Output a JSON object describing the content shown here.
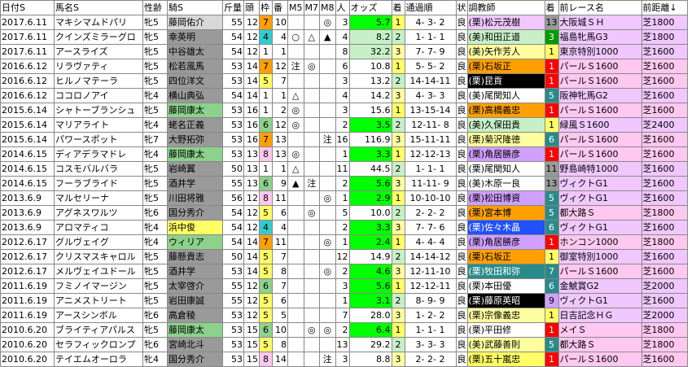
{
  "headers": [
    "日付S",
    "馬名S",
    "性齢",
    "騎S",
    "斤量",
    "頭",
    "枠",
    "番",
    "M5",
    "M7",
    "M8",
    "人",
    "オッズ",
    "着",
    "通過順",
    "状",
    "調教師",
    "着",
    "前レース名",
    "前距離↓"
  ],
  "rows": [
    {
      "date": "2017.6.11",
      "horse": "マキシマムドパリ",
      "sexage": "牝5",
      "jockey": "藤岡佑介",
      "kinryo": "55",
      "heads": "12",
      "waku": "7",
      "ban": "10",
      "m5": "",
      "m7": "",
      "m8": "◎",
      "ninki": "3",
      "odds": "5.7",
      "chaku": "1",
      "tsuka": "4- 3- 2",
      "jo": "良",
      "trainer": "(栗)松元茂樹",
      "prev_chaku": "13",
      "prev_race": "大阪城ＳＨ",
      "prev_dist": "芝1800",
      "jrow": "bg-wgray",
      "wakuc": "bg-orange",
      "oddsc": "bg-zgreen",
      "chakuc": "bg-yellow",
      "trc": "bg-lavender",
      "pcc": "bg-mgray",
      "prc": "bg-lavender",
      "pdc": "bg-lavender"
    },
    {
      "date": "2017.6.11",
      "horse": "クインズミラーグロ",
      "sexage": "牝5",
      "jockey": "幸英明",
      "kinryo": "54",
      "heads": "12",
      "waku": "4",
      "ban": "4",
      "m5": "○",
      "m7": "△",
      "m8": "▲",
      "ninki": "4",
      "odds": "8.2",
      "chaku": "2",
      "tsuka": "1- 1- 1",
      "jo": "良",
      "trainer": "(美)和田正道",
      "prev_chaku": "3",
      "prev_race": "福島牝馬G3",
      "prev_dist": "芝1800",
      "jrow": "bg-mgray",
      "wakuc": "bg-cyan",
      "oddsc": "bg-lgreen",
      "chakuc": "bg-lgreen",
      "trc": "bg-lgreen",
      "pcc": "bg-dkgreen",
      "prc": "bg-lavender",
      "pdc": "bg-lavender"
    },
    {
      "date": "2017.6.11",
      "horse": "アースライズ",
      "sexage": "牝5",
      "jockey": "中谷雄太",
      "kinryo": "54",
      "heads": "12",
      "waku": "1",
      "ban": "1",
      "m5": "",
      "m7": "",
      "m8": "",
      "ninki": "8",
      "odds": "32.2",
      "chaku": "3",
      "tsuka": "7- 7- 9",
      "jo": "良",
      "trainer": "(美)矢作芳人",
      "prev_chaku": "1",
      "prev_race": "東京特別1000",
      "prev_dist": "芝1600",
      "jrow": "bg-mgray",
      "wakuc": "",
      "oddsc": "bg-lgreen",
      "chakuc": "bg-lyellow",
      "trc": "bg-lyellow",
      "pcc": "bg-yellow",
      "prc": "bg-lavender",
      "pdc": "bg-lavender"
    },
    {
      "date": "2016.6.12",
      "horse": "リラヴァティ",
      "sexage": "牝5",
      "jockey": "松若風馬",
      "kinryo": "53",
      "heads": "14",
      "waku": "7",
      "ban": "12",
      "m5": "注",
      "m7": "◎",
      "m8": "",
      "ninki": "6",
      "odds": "10.8",
      "chaku": "1",
      "tsuka": "5- 5- 2",
      "jo": "良",
      "trainer": "(栗)石坂正",
      "prev_chaku": "1",
      "prev_race": "パールＳ1600",
      "prev_dist": "芝1600",
      "jrow": "bg-mgray",
      "wakuc": "bg-orange",
      "oddsc": "",
      "chakuc": "bg-yellow",
      "trc": "bg-orange",
      "pcc": "bg-red",
      "prc": "bg-pink",
      "pdc": "bg-pink"
    },
    {
      "date": "2016.6.12",
      "horse": "ヒルノマテーラ",
      "sexage": "牝5",
      "jockey": "四位洋文",
      "kinryo": "53",
      "heads": "14",
      "waku": "5",
      "ban": "7",
      "m5": "",
      "m7": "",
      "m8": "",
      "ninki": "3",
      "odds": "13.2",
      "chaku": "2",
      "tsuka": "14-14-11",
      "jo": "良",
      "trainer": "(栗)昆貢",
      "prev_chaku": "1",
      "prev_race": "パールＳ1600",
      "prev_dist": "芝1600",
      "jrow": "bg-mgray",
      "wakuc": "bg-yellow",
      "oddsc": "",
      "chakuc": "bg-lgreen",
      "trc": "bg-black",
      "pcc": "bg-red",
      "prc": "bg-pink",
      "pdc": "bg-pink"
    },
    {
      "date": "2016.6.12",
      "horse": "ココロノアイ",
      "sexage": "牝4",
      "jockey": "横山典弘",
      "kinryo": "54",
      "heads": "14",
      "waku": "1",
      "ban": "1",
      "m5": "△",
      "m7": "",
      "m8": "",
      "ninki": "4",
      "odds": "14.2",
      "chaku": "3",
      "tsuka": "4- 3- 3",
      "jo": "良",
      "trainer": "(美)尾関知人",
      "prev_chaku": "5",
      "prev_race": "阪神牝馬G2",
      "prev_dist": "芝1600",
      "jrow": "bg-mgray",
      "wakuc": "",
      "oddsc": "",
      "chakuc": "bg-lyellow",
      "trc": "",
      "pcc": "bg-teal",
      "prc": "bg-lavender",
      "pdc": "bg-lavender"
    },
    {
      "date": "2015.6.14",
      "horse": "シャトーブランシュ",
      "sexage": "牝5",
      "jockey": "藤岡康太",
      "kinryo": "53",
      "heads": "16",
      "waku": "1",
      "ban": "2",
      "m5": "◎",
      "m7": "",
      "m8": "",
      "ninki": "3",
      "odds": "15.6",
      "chaku": "1",
      "tsuka": "13-15-14",
      "jo": "良",
      "trainer": "(栗)高橋義忠",
      "prev_chaku": "1",
      "prev_race": "パールＳ1600",
      "prev_dist": "芝1600",
      "jrow": "bg-green",
      "wakuc": "",
      "oddsc": "",
      "chakuc": "bg-yellow",
      "trc": "bg-orange",
      "pcc": "bg-red",
      "prc": "bg-pink",
      "pdc": "bg-pink"
    },
    {
      "date": "2015.6.14",
      "horse": "マリアライト",
      "sexage": "牝4",
      "jockey": "蛯名正義",
      "kinryo": "53",
      "heads": "16",
      "waku": "6",
      "ban": "12",
      "m5": "◎",
      "m7": "",
      "m8": "",
      "ninki": "2",
      "odds": "3.5",
      "chaku": "2",
      "tsuka": "12-11- 8",
      "jo": "良",
      "trainer": "(美)久保田貴",
      "prev_chaku": "1",
      "prev_race": "緑風Ｓ1600",
      "prev_dist": "芝2400",
      "jrow": "bg-mgray",
      "wakuc": "bg-green",
      "oddsc": "bg-zgreen",
      "chakuc": "bg-lgreen",
      "trc": "bg-lgreen",
      "pcc": "bg-yellow",
      "prc": "bg-lavender",
      "pdc": "bg-lavender"
    },
    {
      "date": "2015.6.14",
      "horse": "パワースポット",
      "sexage": "牝7",
      "jockey": "大野拓弥",
      "kinryo": "53",
      "heads": "16",
      "waku": "7",
      "ban": "13",
      "m5": "",
      "m7": "",
      "m8": "注",
      "ninki": "16",
      "odds": "116.9",
      "chaku": "3",
      "tsuka": "15-11-11",
      "jo": "良",
      "trainer": "(栗)菊沢隆徳",
      "prev_chaku": "6",
      "prev_race": "パールＳ1600",
      "prev_dist": "芝1600",
      "jrow": "bg-mgray",
      "wakuc": "bg-orange",
      "oddsc": "",
      "chakuc": "bg-lyellow",
      "trc": "bg-lyellow",
      "pcc": "bg-teal",
      "prc": "bg-pink",
      "pdc": "bg-pink"
    },
    {
      "date": "2014.6.15",
      "horse": "ディアデラマドレ",
      "sexage": "牝4",
      "jockey": "藤岡康太",
      "kinryo": "53",
      "heads": "13",
      "waku": "8",
      "ban": "13",
      "m5": "◎",
      "m7": "",
      "m8": "",
      "ninki": "1",
      "odds": "3.3",
      "chaku": "1",
      "tsuka": "12-12-13",
      "jo": "良",
      "trainer": "(栗)角居勝彦",
      "prev_chaku": "1",
      "prev_race": "パールＳ1600",
      "prev_dist": "芝1600",
      "jrow": "bg-green",
      "wakuc": "bg-pink",
      "oddsc": "bg-zgreen",
      "chakuc": "bg-yellow",
      "trc": "bg-purple",
      "pcc": "bg-red",
      "prc": "bg-pink",
      "pdc": "bg-pink"
    },
    {
      "date": "2014.6.15",
      "horse": "コスモバルバラ",
      "sexage": "牝5",
      "jockey": "岩崎翼",
      "kinryo": "50",
      "heads": "13",
      "waku": "1",
      "ban": "1",
      "m5": "△",
      "m7": "",
      "m8": "",
      "ninki": "11",
      "odds": "44.5",
      "chaku": "2",
      "tsuka": "1- 1- 1",
      "jo": "良",
      "trainer": "(栗)尾関知人",
      "prev_chaku": "11",
      "prev_race": "野島崎特1000",
      "prev_dist": "芝1600",
      "jrow": "bg-mgray",
      "wakuc": "",
      "oddsc": "",
      "chakuc": "bg-lgreen",
      "trc": "",
      "pcc": "bg-mgray",
      "prc": "bg-lavender",
      "pdc": "bg-lavender"
    },
    {
      "date": "2014.6.15",
      "horse": "フーラブライド",
      "sexage": "牝5",
      "jockey": "酒井学",
      "kinryo": "55",
      "heads": "13",
      "waku": "6",
      "ban": "9",
      "m5": "▲",
      "m7": "注",
      "m8": "",
      "ninki": "2",
      "odds": "5.6",
      "chaku": "3",
      "tsuka": "11-11- 9",
      "jo": "良",
      "trainer": "(美)木原一良",
      "prev_chaku": "13",
      "prev_race": "ヴィクトG1",
      "prev_dist": "芝1600",
      "jrow": "bg-mgray",
      "wakuc": "bg-green",
      "oddsc": "bg-zgreen",
      "chakuc": "bg-lyellow",
      "trc": "",
      "pcc": "bg-mgray",
      "prc": "bg-lavender",
      "pdc": "bg-lavender"
    },
    {
      "date": "2013.6.9",
      "horse": "マルセリーナ",
      "sexage": "牝5",
      "jockey": "川田将雅",
      "kinryo": "56",
      "heads": "12",
      "waku": "8",
      "ban": "11",
      "m5": "",
      "m7": "",
      "m8": "◎",
      "ninki": "1",
      "odds": "2.9",
      "chaku": "1",
      "tsuka": "10-10-10",
      "jo": "良",
      "trainer": "(栗)松田博資",
      "prev_chaku": "5",
      "prev_race": "ヴィクトG1",
      "prev_dist": "芝1600",
      "jrow": "bg-mgray",
      "wakuc": "bg-pink",
      "oddsc": "bg-zgreen",
      "chakuc": "bg-yellow",
      "trc": "bg-purple",
      "pcc": "bg-teal",
      "prc": "bg-lavender",
      "pdc": "bg-lavender"
    },
    {
      "date": "2013.6.9",
      "horse": "アグネスワルツ",
      "sexage": "牝6",
      "jockey": "国分秀介",
      "kinryo": "54",
      "heads": "12",
      "waku": "5",
      "ban": "6",
      "m5": "",
      "m7": "◎",
      "m8": "",
      "ninki": "5",
      "odds": "10.0",
      "chaku": "2",
      "tsuka": "2- 2- 2",
      "jo": "良",
      "trainer": "(栗)宮本博",
      "prev_chaku": "5",
      "prev_race": "都大路Ｓ",
      "prev_dist": "芝1800",
      "jrow": "bg-mgray",
      "wakuc": "bg-yellow",
      "oddsc": "",
      "chakuc": "bg-lgreen",
      "trc": "bg-orange",
      "pcc": "bg-teal",
      "prc": "bg-pink",
      "pdc": "bg-pink"
    },
    {
      "date": "2013.6.9",
      "horse": "アロマティコ",
      "sexage": "牝4",
      "jockey": "浜中俊",
      "kinryo": "54",
      "heads": "12",
      "waku": "4",
      "ban": "4",
      "m5": "",
      "m7": "",
      "m8": "",
      "ninki": "2",
      "odds": "3.3",
      "chaku": "3",
      "tsuka": "7- 7- 6",
      "jo": "良",
      "trainer": "(栗)佐々木晶",
      "prev_chaku": "6",
      "prev_race": "ヴィクトG1",
      "prev_dist": "芝1600",
      "jrow": "bg-yellow",
      "wakuc": "bg-cyan",
      "oddsc": "bg-zgreen",
      "chakuc": "bg-lyellow",
      "trc": "bg-blue",
      "pcc": "bg-teal",
      "prc": "bg-lavender",
      "pdc": "bg-lavender"
    },
    {
      "date": "2012.6.17",
      "horse": "グルヴェイグ",
      "sexage": "牝4",
      "jockey": "ウィリア",
      "kinryo": "54",
      "heads": "14",
      "waku": "7",
      "ban": "11",
      "m5": "",
      "m7": "",
      "m8": "◎",
      "ninki": "1",
      "odds": "2.4",
      "chaku": "1",
      "tsuka": "4- 4- 4",
      "jo": "良",
      "trainer": "(栗)角居勝彦",
      "prev_chaku": "1",
      "prev_race": "ホンコン1000",
      "prev_dist": "芝1800",
      "jrow": "bg-green",
      "wakuc": "bg-orange",
      "oddsc": "bg-zgreen",
      "chakuc": "bg-yellow",
      "trc": "bg-purple",
      "pcc": "bg-red",
      "prc": "bg-pink",
      "pdc": "bg-pink"
    },
    {
      "date": "2012.6.17",
      "horse": "クリスマスキャロル",
      "sexage": "牝5",
      "jockey": "藤懸貴志",
      "kinryo": "50",
      "heads": "14",
      "waku": "5",
      "ban": "7",
      "m5": "",
      "m7": "",
      "m8": "",
      "ninki": "12",
      "odds": "14.9",
      "chaku": "2",
      "tsuka": "14-14-12",
      "jo": "良",
      "trainer": "(栗)石坂正",
      "prev_chaku": "1",
      "prev_race": "御室特別1000",
      "prev_dist": "芝1600",
      "jrow": "bg-mgray",
      "wakuc": "bg-yellow",
      "oddsc": "",
      "chakuc": "bg-lgreen",
      "trc": "bg-orange",
      "pcc": "bg-yellow",
      "prc": "bg-lavender",
      "pdc": "bg-lavender"
    },
    {
      "date": "2012.6.17",
      "horse": "メルヴェイユドール",
      "sexage": "牝5",
      "jockey": "酒井学",
      "kinryo": "53",
      "heads": "14",
      "waku": "5",
      "ban": "8",
      "m5": "",
      "m7": "",
      "m8": "◎",
      "ninki": "2",
      "odds": "4.6",
      "chaku": "3",
      "tsuka": "12-11-10",
      "jo": "良",
      "trainer": "(栗)牧田和弥",
      "prev_chaku": "7",
      "prev_race": "パールＳ1600",
      "prev_dist": "芝1600",
      "jrow": "bg-mgray",
      "wakuc": "bg-yellow",
      "oddsc": "bg-zgreen",
      "chakuc": "bg-lyellow",
      "trc": "bg-teal",
      "pcc": "bg-teal",
      "prc": "bg-pink",
      "pdc": "bg-pink"
    },
    {
      "date": "2011.6.19",
      "horse": "フミノイマージン",
      "sexage": "牝5",
      "jockey": "太宰啓介",
      "kinryo": "55",
      "heads": "12",
      "waku": "6",
      "ban": "7",
      "m5": "",
      "m7": "",
      "m8": "",
      "ninki": "3",
      "odds": "5.6",
      "chaku": "1",
      "tsuka": "12-12-11",
      "jo": "良",
      "trainer": "(栗)本田優",
      "prev_chaku": "6",
      "prev_race": "金鯱賞G2",
      "prev_dist": "芝2000",
      "jrow": "bg-mgray",
      "wakuc": "bg-green",
      "oddsc": "bg-zgreen",
      "chakuc": "bg-yellow",
      "trc": "",
      "pcc": "bg-teal",
      "prc": "bg-lavender",
      "pdc": "bg-lavender"
    },
    {
      "date": "2011.6.19",
      "horse": "アニメストリート",
      "sexage": "牝5",
      "jockey": "岩田康誠",
      "kinryo": "55",
      "heads": "12",
      "waku": "5",
      "ban": "6",
      "m5": "",
      "m7": "",
      "m8": "",
      "ninki": "1",
      "odds": "3.1",
      "chaku": "2",
      "tsuka": "8- 9- 9",
      "jo": "良",
      "trainer": "(栗)藤原英昭",
      "prev_chaku": "9",
      "prev_race": "ヴィクトG1",
      "prev_dist": "芝1600",
      "jrow": "bg-mgray",
      "wakuc": "bg-yellow",
      "oddsc": "bg-zgreen",
      "chakuc": "bg-lgreen",
      "trc": "bg-black",
      "pcc": "bg-purple",
      "prc": "bg-lavender",
      "pdc": "bg-lavender"
    },
    {
      "date": "2011.6.19",
      "horse": "アースシンボル",
      "sexage": "牝6",
      "jockey": "高倉稜",
      "kinryo": "53",
      "heads": "12",
      "waku": "5",
      "ban": "5",
      "m5": "",
      "m7": "",
      "m8": "",
      "ninki": "7",
      "odds": "28.0",
      "chaku": "3",
      "tsuka": "1- 2- 2",
      "jo": "良",
      "trainer": "(栗)宗像義忠",
      "prev_chaku": "1",
      "prev_race": "日吉記念ＨＧ",
      "prev_dist": "芝2000",
      "jrow": "bg-mgray",
      "wakuc": "bg-yellow",
      "oddsc": "",
      "chakuc": "bg-lyellow",
      "trc": "bg-lyellow",
      "pcc": "bg-yellow",
      "prc": "bg-lavender",
      "pdc": "bg-lavender"
    },
    {
      "date": "2010.6.20",
      "horse": "ブライティアパルス",
      "sexage": "牝5",
      "jockey": "藤岡康太",
      "kinryo": "53",
      "heads": "15",
      "waku": "6",
      "ban": "10",
      "m5": "",
      "m7": "◎",
      "m8": "◎",
      "ninki": "2",
      "odds": "6.4",
      "chaku": "1",
      "tsuka": "1- 1- 1",
      "jo": "良",
      "trainer": "(栗)平田修",
      "prev_chaku": "1",
      "prev_race": "メイＳ",
      "prev_dist": "芝1800",
      "jrow": "bg-green",
      "wakuc": "bg-green",
      "oddsc": "bg-zgreen",
      "chakuc": "bg-yellow",
      "trc": "",
      "pcc": "bg-red",
      "prc": "bg-pink",
      "pdc": "bg-pink"
    },
    {
      "date": "2010.6.20",
      "horse": "セラフィックロンプ",
      "sexage": "牝6",
      "jockey": "宮崎北斗",
      "kinryo": "53",
      "heads": "15",
      "waku": "5",
      "ban": "8",
      "m5": "",
      "m7": "",
      "m8": "",
      "ninki": "13",
      "odds": "29.2",
      "chaku": "2",
      "tsuka": "3- 3- 3",
      "jo": "良",
      "trainer": "(美)武藤善則",
      "prev_chaku": "5",
      "prev_race": "都大路Ｓ",
      "prev_dist": "芝1800",
      "jrow": "bg-mgray",
      "wakuc": "bg-yellow",
      "oddsc": "",
      "chakuc": "bg-lgreen",
      "trc": "bg-lyellow",
      "pcc": "bg-teal",
      "prc": "bg-pink",
      "pdc": "bg-pink"
    },
    {
      "date": "2010.6.20",
      "horse": "テイエムオーロラ",
      "sexage": "牝4",
      "jockey": "国分秀介",
      "kinryo": "53",
      "heads": "15",
      "waku": "8",
      "ban": "14",
      "m5": "",
      "m7": "",
      "m8": "注",
      "ninki": "3",
      "odds": "8.8",
      "chaku": "3",
      "tsuka": "2- 2- 2",
      "jo": "良",
      "trainer": "(栗)五十嵐忠",
      "prev_chaku": "1",
      "prev_race": "パールＳ1600",
      "prev_dist": "芝1600",
      "jrow": "bg-mgray",
      "wakuc": "bg-pink",
      "oddsc": "",
      "chakuc": "bg-lyellow",
      "trc": "bg-yellow",
      "pcc": "bg-red",
      "prc": "bg-pink",
      "pdc": "bg-pink"
    }
  ]
}
